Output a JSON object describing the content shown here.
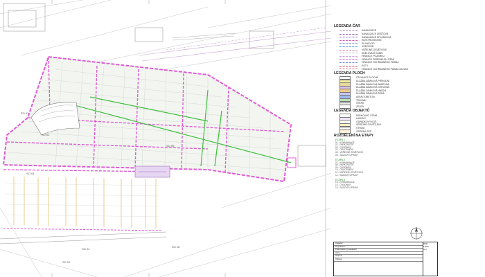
{
  "legend": {
    "lines_title": "LEGENDA ČAR",
    "lines": [
      {
        "color": "#c27ab8",
        "label": "KANALIZACE"
      },
      {
        "color": "#9a5bb0",
        "label": "KANALIZACE DEŠŤOVÁ"
      },
      {
        "color": "#8a63c8",
        "label": "KANALIZACE SPLAŠKOVÁ"
      },
      {
        "color": "#d35db7",
        "label": "ELEKTROVEDENÍ"
      },
      {
        "color": "#7e9ad6",
        "label": "PLYNOVOD"
      },
      {
        "color": "#5aa0d8",
        "label": "VODOVOD"
      },
      {
        "color": "#e08aa0",
        "label": "VEŘEJNÉ OSVĚTLENÍ"
      },
      {
        "color": "#b0b0b0",
        "label": "SDĚLOVACÍ KABEL"
      },
      {
        "color": "#c9a0d8",
        "label": "HRANICE POZEMKU"
      },
      {
        "color": "#e06ad0",
        "label": "HRANICE ŘEŠENÉHO ÚZEMÍ"
      },
      {
        "color": "#6a8ad0",
        "label": "HRANICE OCHRANNÉHO PÁSMA"
      },
      {
        "color": "#d04040",
        "label": "KÓTY"
      },
      {
        "color": "#e07070",
        "label": "HRANICE OCHRANNÉHO PÁSMA SILNICE"
      }
    ],
    "areas_title": "LEGENDA PLOCH",
    "areas": [
      {
        "color": "#ffffff",
        "label": "STÁVAJÍCÍ PLOCHA"
      },
      {
        "color": "#f4f0a0",
        "label": "DLAŽBA ZÁMKOVÁ PŘÍRODNÍ"
      },
      {
        "color": "#e8d89a",
        "label": "DLAŽBA ZÁMKOVÁ BAREVNÁ"
      },
      {
        "color": "#d9c4e8",
        "label": "DLAŽBA ZÁMKOVÁ ČERVENÁ"
      },
      {
        "color": "#f2c88a",
        "label": "DLAŽBA ZÁMKOVÁ HNĚDÁ"
      },
      {
        "color": "#c8c8f0",
        "label": "DLAŽBA ZÁMKOVÁ ŠEDÁ"
      },
      {
        "color": "#9fb8ee",
        "label": "ASFALTOBETON"
      },
      {
        "color": "#b6e0b6",
        "label": "TRÁVNÍK"
      },
      {
        "color": "#e8e8e8",
        "label": "ŠTĚRK"
      },
      {
        "color": "#ffffff",
        "label": "ZELEŇ"
      }
    ],
    "objects_title": "LEGENDA OBJEKTŮ",
    "objects": [
      {
        "color": "#ffffff",
        "label": "PARKOVACÍ STÁNÍ"
      },
      {
        "color": "#f0e6ff",
        "label": "LAVIČKY"
      },
      {
        "color": "#ffffff",
        "label": "ODPADKOVÝ KOŠ"
      },
      {
        "color": "#f7f0c0",
        "label": "VEŘEJNÉ OSVĚTLENÍ"
      },
      {
        "color": "#ffffff",
        "label": "STROM"
      },
      {
        "color": "#fff0d8",
        "label": "OPĚRNÁ ZEĎ"
      }
    ],
    "stages_title": "ROZDĚLENÍ NA ETAPY",
    "stages": [
      {
        "head": "ETAPA 1",
        "items": [
          "01 - KOMUNIKACE",
          "02 - PARKOVIŠTĚ",
          "03 - CHODNÍKY",
          "04 - ODVODNĚNÍ",
          "05 - VEŘEJNÉ OSVĚTLENÍ",
          "06 - SADOVÉ ÚPRAVY"
        ]
      },
      {
        "head": "ETAPA 2",
        "items": [
          "07 - KOMUNIKACE",
          "08 - PARKOVIŠTĚ",
          "09 - CHODNÍKY",
          "10 - ODVODNĚNÍ",
          "11 - VEŘEJNÉ OSVĚTLENÍ",
          "12 - SADOVÉ ÚPRAVY"
        ]
      },
      {
        "head": "ETAPA 3",
        "items": [
          "13 - KOMUNIKACE",
          "14 - CHODNÍKY",
          "15 - SADOVÉ ÚPRAVY"
        ]
      }
    ]
  },
  "title_block": {
    "rows": [
      "Investor:",
      "Projektant:",
      "Zodpovědný projektant:",
      "Akce:",
      "Stupeň:",
      "Výkres:"
    ],
    "side": [
      "DSP",
      "1:500",
      "C.3"
    ]
  },
  "footnote": "",
  "plan": {
    "labels": [
      "SO 01",
      "SO 02",
      "SO 03",
      "SO 04",
      "SO 05",
      "SO 06",
      "SO 07"
    ]
  }
}
